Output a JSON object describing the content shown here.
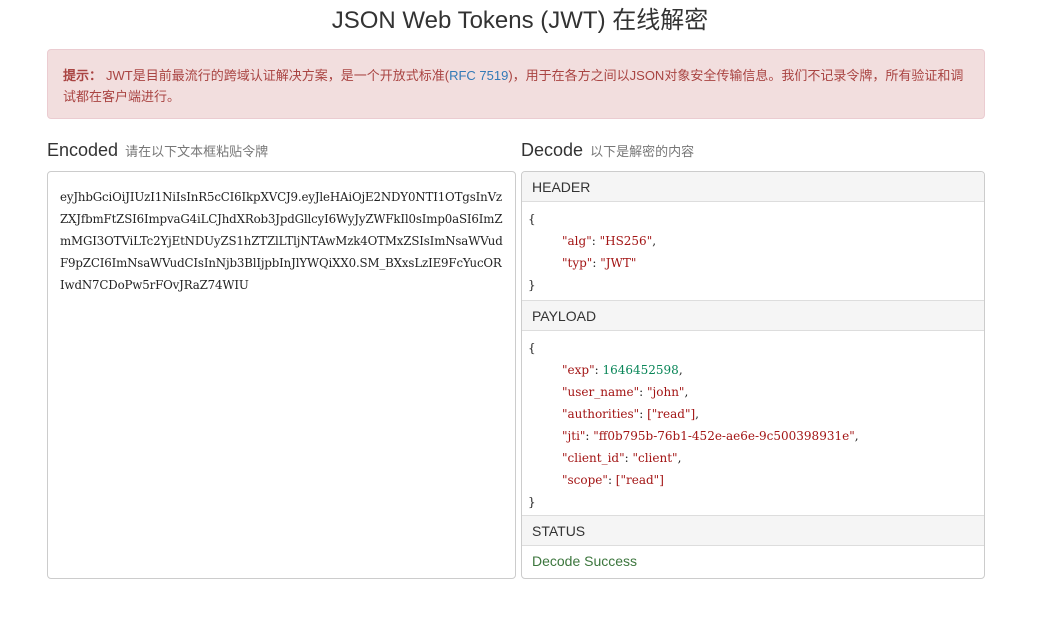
{
  "title": "JSON Web Tokens (JWT) 在线解密",
  "alert": {
    "label": "提示：",
    "text_before": "JWT是目前最流行的跨域认证解决方案，是一个开放式标准(",
    "rfc": "RFC 7519",
    "text_after": ")，用于在各方之间以JSON对象安全传输信息。我们不记录令牌，所有验证和调试都在客户端进行。"
  },
  "encoded": {
    "title": "Encoded",
    "subtitle": "请在以下文本框粘贴令牌",
    "token": "eyJhbGciOiJIUzI1NiIsInR5cCI6IkpXVCJ9.eyJleHAiOjE2NDY0NTI1OTgsInVzZXJfbmFtZSI6ImpvaG4iLCJhdXRob3JpdGllcyI6WyJyZWFkIl0sImp0aSI6ImZmMGI3OTViLTc2YjEtNDUyZS1hZTZlLTljNTAwMzk4OTMxZSIsImNsaWVudF9pZCI6ImNsaWVudCIsInNjb3BlIjpbInJlYWQiXX0.SM_BXxsLzIE9FcYucORIwdN7CDoPw5rFOvJRaZ74WIU"
  },
  "decode": {
    "title": "Decode",
    "subtitle": "以下是解密的内容",
    "header_label": "HEADER",
    "header": {
      "open": "{",
      "close": "}",
      "alg_key": "\"alg\"",
      "alg_val": "\"HS256\"",
      "typ_key": "\"typ\"",
      "typ_val": "\"JWT\""
    },
    "payload_label": "PAYLOAD",
    "payload": {
      "open": "{",
      "close": "}",
      "exp_key": "\"exp\"",
      "exp_val": "1646452598",
      "user_name_key": "\"user_name\"",
      "user_name_val": "\"john\"",
      "authorities_key": "\"authorities\"",
      "authorities_val": "[\"read\"]",
      "jti_key": "\"jti\"",
      "jti_val": "\"ff0b795b-76b1-452e-ae6e-9c500398931e\"",
      "client_id_key": "\"client_id\"",
      "client_id_val": "\"client\"",
      "scope_key": "\"scope\"",
      "scope_val": "[\"read\"]"
    },
    "status_label": "STATUS",
    "status_text": "Decode Success"
  }
}
